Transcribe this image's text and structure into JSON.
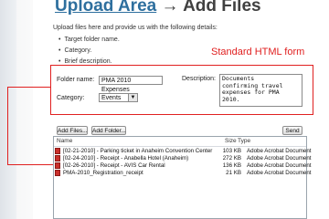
{
  "header": {
    "title_link": "Upload Area",
    "title_rest": " → Add Files",
    "intro": "Upload files here and provide us with the following details:",
    "bullets": [
      "Target folder name.",
      "Category.",
      "Brief description."
    ]
  },
  "annotation": {
    "caption": "Standard HTML form",
    "color": "#e02020"
  },
  "form": {
    "folder_label": "Folder name:",
    "folder_value": "PMA 2010 Expenses",
    "category_label": "Category:",
    "category_value": "Events",
    "description_label": "Description:",
    "description_lines": [
      "Documents",
      "confirming travel",
      "expenses for PMA",
      "2010."
    ]
  },
  "uploader": {
    "add_files_label": "Add Files...",
    "add_folder_label": "Add Folder...",
    "send_label": "Send",
    "columns": {
      "name": "Name",
      "size": "Size",
      "type": "Type"
    },
    "files": [
      {
        "name": "[02-21-2010] - Parking ticket in Anaheim Convention Center",
        "size": "103 KB",
        "type": "Adobe Acrobat Document"
      },
      {
        "name": "[02-24-2010] - Receipt - Anabella Hotel (Anaheim)",
        "size": "272 KB",
        "type": "Adobe Acrobat Document"
      },
      {
        "name": "[02-26-2010] - Receipt - AVIS Car Rental",
        "size": "136 KB",
        "type": "Adobe Acrobat Document"
      },
      {
        "name": "PMA-2010_Registration_receipt",
        "size": "21 KB",
        "type": "Adobe Acrobat Document"
      }
    ]
  },
  "colors": {
    "accent": "#2e6f9e",
    "annotation": "#e02020"
  }
}
